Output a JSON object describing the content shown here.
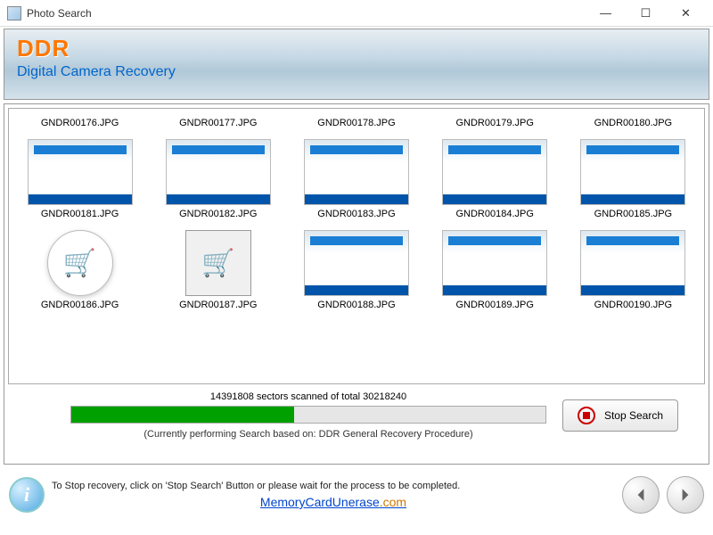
{
  "window": {
    "title": "Photo Search"
  },
  "banner": {
    "logo": "DDR",
    "subtitle": "Digital Camera Recovery"
  },
  "thumbnails": {
    "row1": [
      "GNDR00176.JPG",
      "GNDR00177.JPG",
      "GNDR00178.JPG",
      "GNDR00179.JPG",
      "GNDR00180.JPG"
    ],
    "row2": [
      "GNDR00181.JPG",
      "GNDR00182.JPG",
      "GNDR00183.JPG",
      "GNDR00184.JPG",
      "GNDR00185.JPG"
    ],
    "row3": [
      "GNDR00186.JPG",
      "GNDR00187.JPG",
      "GNDR00188.JPG",
      "GNDR00189.JPG",
      "GNDR00190.JPG"
    ]
  },
  "progress": {
    "scanned": 14391808,
    "total": 30218240,
    "text": "14391808 sectors scanned of total 30218240",
    "note": "(Currently performing Search based on:  DDR General Recovery Procedure)",
    "percent": 47
  },
  "buttons": {
    "stop": "Stop Search"
  },
  "footer": {
    "msg": "To Stop recovery, click on 'Stop Search' Button or please wait for the process to be completed.",
    "link_main": "MemoryCardUnerase",
    "link_com": ".com"
  }
}
